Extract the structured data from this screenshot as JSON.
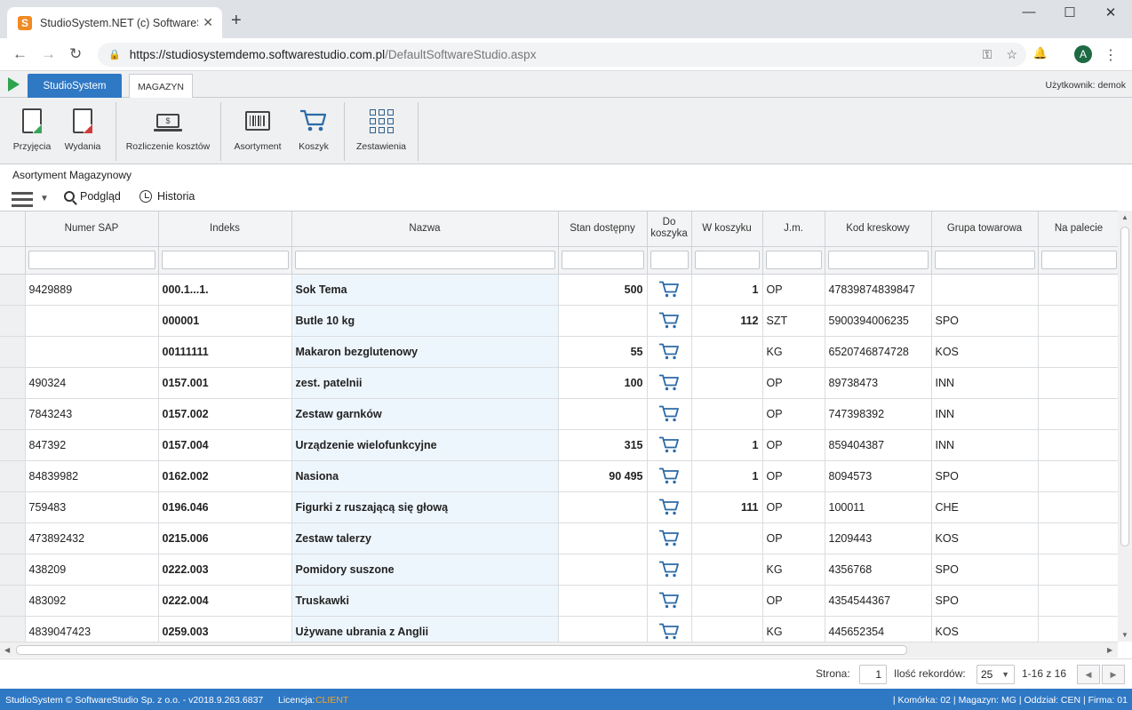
{
  "browser": {
    "tab_title": "StudioSystem.NET (c) SoftwareSt",
    "url_host": "https://studiosystemdemo.softwarestudio.com.pl",
    "url_path": "/DefaultSoftwareStudio.aspx",
    "avatar_letter": "A",
    "favicon_letter": "S"
  },
  "app": {
    "tab_main": "StudioSystem",
    "tab_active": "MAGAZYN",
    "user": "Użytkownik: demok"
  },
  "ribbon": {
    "przyjecia": "Przyjęcia",
    "wydania": "Wydania",
    "rozliczenie": "Rozliczenie kosztów",
    "asortyment": "Asortyment",
    "koszyk": "Koszyk",
    "zestawienia": "Zestawienia"
  },
  "section_title": "Asortyment Magazynowy",
  "toolbar": {
    "podglad": "Podgląd",
    "historia": "Historia"
  },
  "grid": {
    "columns": [
      "Numer SAP",
      "Indeks",
      "Nazwa",
      "Stan dostępny",
      "Do koszyka",
      "W koszyku",
      "J.m.",
      "Kod kreskowy",
      "Grupa towarowa",
      "Na palecie"
    ],
    "rows": [
      {
        "sap": "9429889",
        "indeks": "000.1...1.",
        "nazwa": "Sok Tema",
        "stan": "500",
        "w_koszyku": "1",
        "jm": "OP",
        "kod": "47839874839847",
        "grupa": ""
      },
      {
        "sap": "",
        "indeks": "000001",
        "nazwa": "Butle 10 kg",
        "stan": "",
        "w_koszyku": "112",
        "jm": "SZT",
        "kod": "5900394006235",
        "grupa": "SPO"
      },
      {
        "sap": "",
        "indeks": "00111111",
        "nazwa": "Makaron bezglutenowy",
        "stan": "55",
        "w_koszyku": "",
        "jm": "KG",
        "kod": "6520746874728",
        "grupa": "KOS"
      },
      {
        "sap": "490324",
        "indeks": "0157.001",
        "nazwa": "zest. patelnii",
        "stan": "100",
        "w_koszyku": "",
        "jm": "OP",
        "kod": "89738473",
        "grupa": "INN"
      },
      {
        "sap": "7843243",
        "indeks": "0157.002",
        "nazwa": "Zestaw garnków",
        "stan": "",
        "w_koszyku": "",
        "jm": "OP",
        "kod": "747398392",
        "grupa": "INN"
      },
      {
        "sap": "847392",
        "indeks": "0157.004",
        "nazwa": "Urządzenie wielofunkcyjne",
        "stan": "315",
        "w_koszyku": "1",
        "jm": "OP",
        "kod": "859404387",
        "grupa": "INN"
      },
      {
        "sap": "84839982",
        "indeks": "0162.002",
        "nazwa": "Nasiona",
        "stan": "90 495",
        "w_koszyku": "1",
        "jm": "OP",
        "kod": "8094573",
        "grupa": "SPO"
      },
      {
        "sap": "759483",
        "indeks": "0196.046",
        "nazwa": "Figurki z ruszającą się głową",
        "stan": "",
        "w_koszyku": "111",
        "jm": "OP",
        "kod": "100011",
        "grupa": "CHE"
      },
      {
        "sap": "473892432",
        "indeks": "0215.006",
        "nazwa": "Zestaw talerzy",
        "stan": "",
        "w_koszyku": "",
        "jm": "OP",
        "kod": "1209443",
        "grupa": "KOS"
      },
      {
        "sap": "438209",
        "indeks": "0222.003",
        "nazwa": "Pomidory suszone",
        "stan": "",
        "w_koszyku": "",
        "jm": "KG",
        "kod": "4356768",
        "grupa": "SPO"
      },
      {
        "sap": "483092",
        "indeks": "0222.004",
        "nazwa": "Truskawki",
        "stan": "",
        "w_koszyku": "",
        "jm": "OP",
        "kod": "4354544367",
        "grupa": "SPO"
      },
      {
        "sap": "4839047423",
        "indeks": "0259.003",
        "nazwa": "Używane ubrania z Anglii",
        "stan": "",
        "w_koszyku": "",
        "jm": "KG",
        "kod": "445652354",
        "grupa": "KOS"
      }
    ]
  },
  "pager": {
    "strona_label": "Strona:",
    "strona_value": "1",
    "ilosc_label": "Ilość rekordów:",
    "ilosc_value": "25",
    "range": "1-16 z 16"
  },
  "status": {
    "copyright": "StudioSystem © SoftwareStudio Sp. z o.o. - v2018.9.263.6837",
    "licencja_label": "Licencja:",
    "licencja_value": "CLIENT",
    "right": "| Komórka: 02 | Magazyn: MG | Oddział: CEN | Firma: 01"
  },
  "colors": {
    "accent": "#2f78c4",
    "cart": "#2b6aa6",
    "license": "#f6a623"
  }
}
